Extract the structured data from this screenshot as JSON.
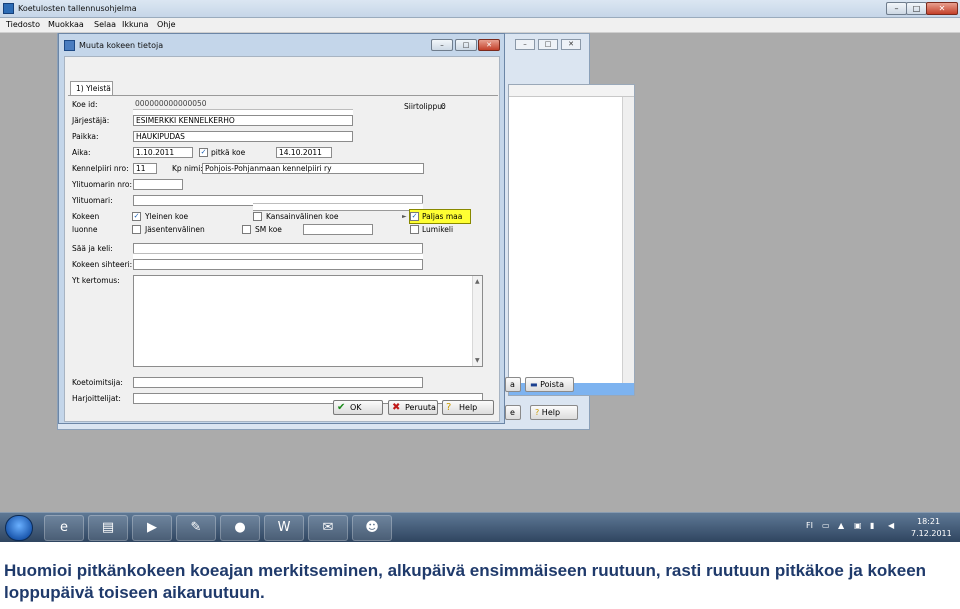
{
  "app": {
    "title": "Koetulosten tallennusohjelma",
    "controls": [
      "–",
      "□",
      "✕"
    ],
    "menu": [
      "Tiedosto",
      "Muokkaa",
      "Selaa",
      "Ikkuna",
      "Ohje"
    ]
  },
  "child_window": {
    "buttons": [
      {
        "label": "a",
        "icon": "arrow-icon"
      },
      {
        "label": "Poista",
        "icon": "minus-icon"
      },
      {
        "label": "e",
        "icon": "door-icon"
      },
      {
        "label": "Help",
        "icon": "help-icon"
      }
    ]
  },
  "dialog": {
    "title": "Muuta kokeen tietoja",
    "tab": "1) Yleistä",
    "labels": {
      "koe_id": "Koe id:",
      "jarjestaja": "Järjestäjä:",
      "paikka": "Paikka:",
      "aika": "Aika:",
      "kennelpiiri": "Kennelpiiri nro:",
      "kp_nimi": "Kp nimi:",
      "ylituomarin_nro": "Ylituomarin nro:",
      "ylituomari": "Ylituomari:",
      "kokeen_luonne_1": "Kokeen",
      "kokeen_luonne_2": "luonne",
      "saa": "Sää ja keli:",
      "sihteeri": "Kokeen sihteeri:",
      "yt_kertomus": "Yt kertomus:",
      "koetoimitsija": "Koetoimitsija:",
      "harjoittelijat": "Harjoittelijat:",
      "siirtolippu": "Siirtolippu:"
    },
    "values": {
      "koe_id": "000000000000050",
      "jarjestaja": "ESIMERKKI KENNELKERHO",
      "paikka": "HAUKIPUDAS",
      "aika_alku": "1.10.2011",
      "aika_loppu": "14.10.2011",
      "kennelpiiri": "11",
      "kp_nimi": "Pohjois-Pohjanmaan kennelpiiri ry",
      "siirtolippu": "0"
    },
    "checks": {
      "pitka_koe": "pitkä koe",
      "yleinen_koe": "Yleinen koe",
      "kansainvalinen_koe": "Kansainvälinen koe",
      "paljas_maa": "Paljas maa",
      "jasentenvalinen": "Jäsentenvälinen",
      "sm_koe": "SM koe",
      "lumikeli": "Lumikeli"
    },
    "buttons": {
      "ok": "OK",
      "peruuta": "Peruuta",
      "help": "Help"
    }
  },
  "taskbar": {
    "items": [
      "ie-icon",
      "explorer-icon",
      "media-player-icon",
      "paint-icon",
      "firefox-icon",
      "word-icon",
      "outlook-icon",
      "smurf-app-icon"
    ],
    "tray_lang": "FI",
    "time": "18:21",
    "date": "7.12.2011"
  },
  "caption": "Huomioi pitkänkokeen koeajan merkitseminen, alkupäivä ensimmäiseen ruutuun, rasti ruutuun pitkäkoe ja kokeen loppupäivä toiseen aikaruutuun."
}
